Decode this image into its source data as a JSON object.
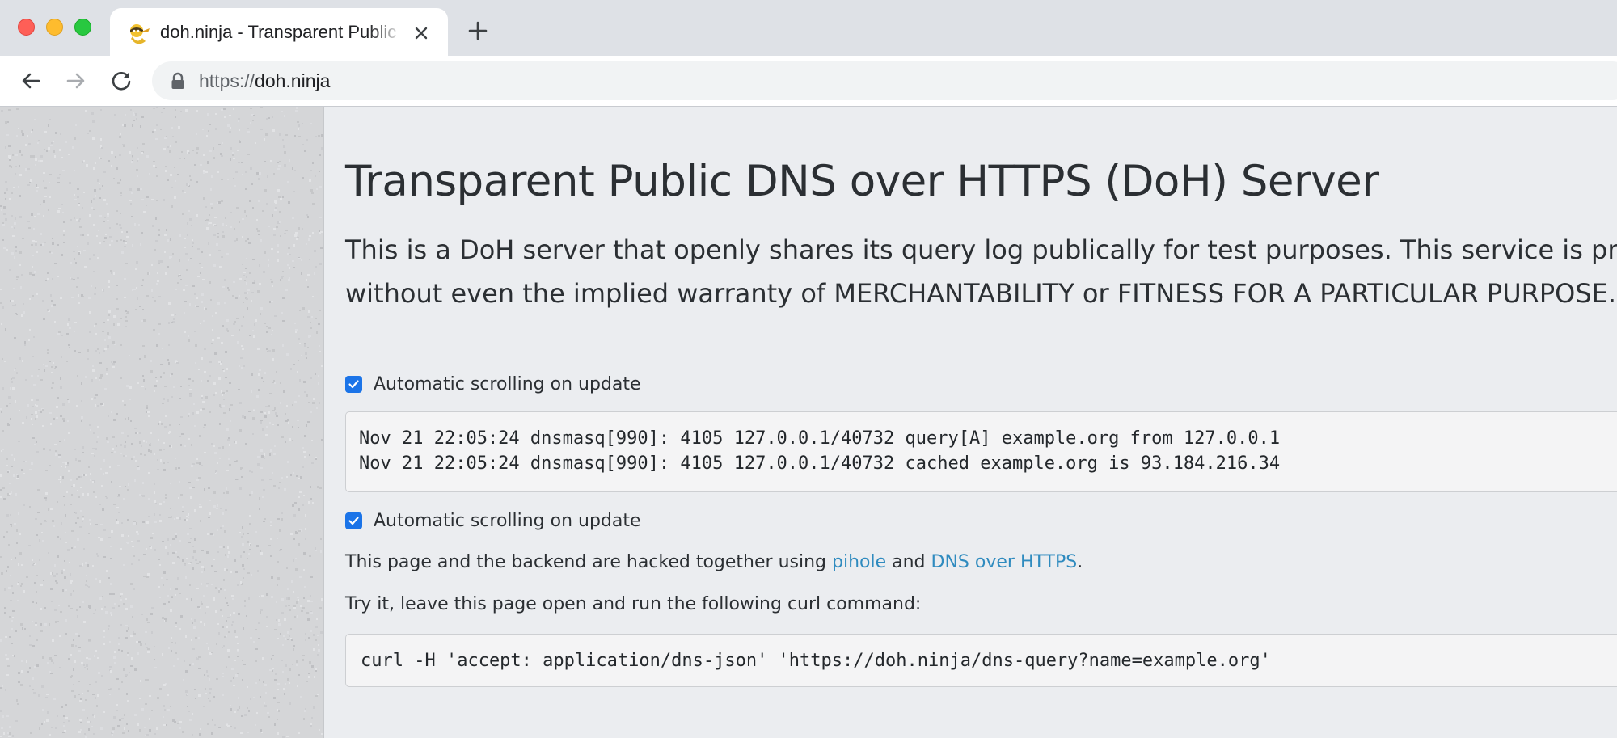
{
  "browser": {
    "tab": {
      "title": "doh.ninja - Transparent Public DNS over HTTPS (DoH) Server",
      "favicon": "ninja-favicon-icon"
    },
    "new_tab_label": "+",
    "address_bar": {
      "scheme": "https://",
      "host": "doh.ninja"
    }
  },
  "page": {
    "title": "Transparent Public DNS over HTTPS (DoH) Server",
    "lead_line_1": "This is a DoH server that openly shares its query log publically for test purposes. This service is prov",
    "lead_line_2": "without even the implied warranty of MERCHANTABILITY or FITNESS FOR A PARTICULAR PURPOSE.",
    "autoscroll_top": {
      "label": "Automatic scrolling on update",
      "checked": true
    },
    "log_lines": [
      "Nov 21 22:05:24 dnsmasq[990]: 4105 127.0.0.1/40732 query[A] example.org from 127.0.0.1",
      "Nov 21 22:05:24 dnsmasq[990]: 4105 127.0.0.1/40732 cached example.org is 93.184.216.34"
    ],
    "autoscroll_bottom": {
      "label": "Automatic scrolling on update",
      "checked": true
    },
    "credits": {
      "prefix": "This page and the backend are hacked together using ",
      "link1": "pihole",
      "middle": " and ",
      "link2": "DNS over HTTPS",
      "suffix": "."
    },
    "try_text": "Try it, leave this page open and run the following curl command:",
    "curl_command": "curl -H 'accept: application/dns-json' 'https://doh.ninja/dns-query?name=example.org'"
  },
  "colors": {
    "accent": "#1b74e8",
    "link": "#2f8bbf",
    "page_bg": "#ebedf0",
    "code_bg": "#f4f4f5"
  }
}
